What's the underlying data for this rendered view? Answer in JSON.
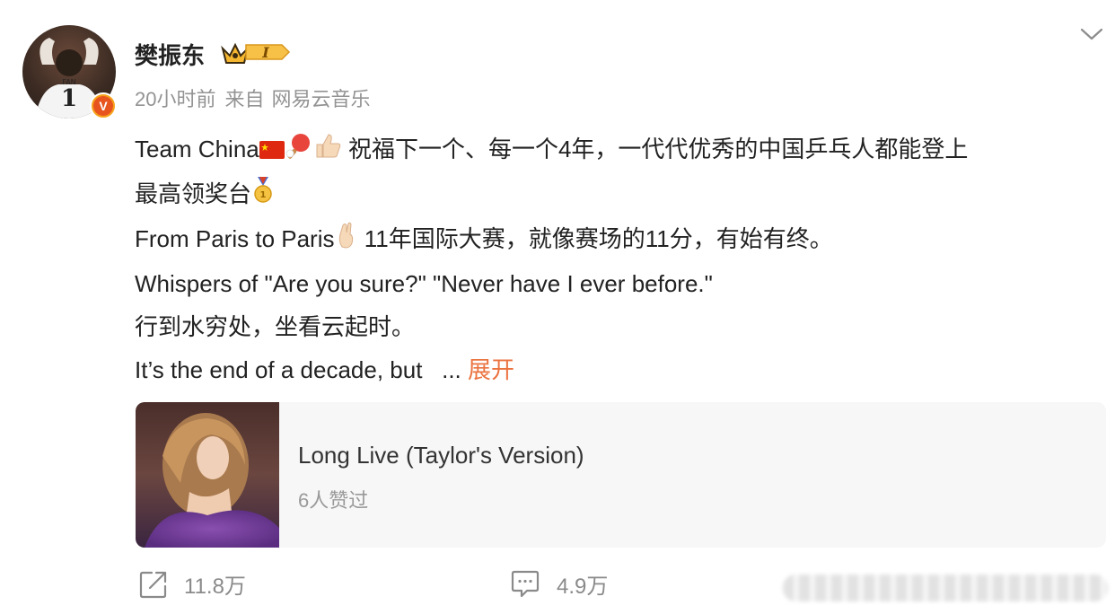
{
  "author": {
    "name": "樊振东",
    "level_badge": "I",
    "verified_mark": "V"
  },
  "meta": {
    "time": "20小时前",
    "source_prefix": "来自",
    "source": "网易云音乐"
  },
  "post": {
    "line1_a": "Team China",
    "line1_b": " 祝福下一个、每一个4年，一代代优秀的中国乒乓人都能登上",
    "line2": "最高领奖台",
    "line3_a": "From Paris to Paris",
    "line3_b": " 11年国际大赛，就像赛场的11分，有始有终。",
    "line4": "Whispers of \"Are you sure?\" \"Never have I ever before.\"",
    "line5": "行到水穷处，坐看云起时。",
    "line6": "It’s the end of a decade, but   ...",
    "expand_label": "展开"
  },
  "music_card": {
    "title": "Long Live (Taylor's Version)",
    "likes": "6人赞过"
  },
  "actions": {
    "share_count": "11.8万",
    "comment_count": "4.9万"
  },
  "colors": {
    "accent": "#eb7340",
    "meta_gray": "#939393",
    "card_bg": "#f7f7f7"
  }
}
